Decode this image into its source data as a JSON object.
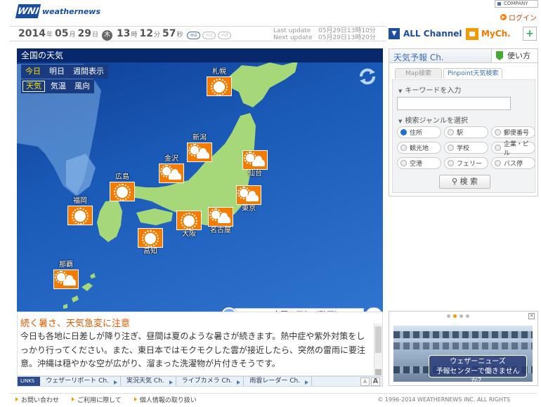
{
  "header": {
    "logo_mark": "WNI",
    "logo_text": "weathernews",
    "company_link": "COMPANY",
    "login_link": "ログイン"
  },
  "datebar": {
    "year": "2014",
    "year_unit": "年",
    "month": "05",
    "month_unit": "月",
    "day": "29",
    "day_unit": "日",
    "weekday": "木",
    "hour": "13",
    "hour_unit": "時",
    "minute": "12",
    "minute_unit": "分",
    "second": "57",
    "second_unit": "秒",
    "segments": [
      "m1",
      "m2",
      "m3"
    ],
    "last_update_label": "Last update",
    "last_update_value": "05月29日13時10分",
    "next_update_label": "Next update",
    "next_update_value": "05月29日13時20分"
  },
  "channels": {
    "all_channel": "ALL Channel",
    "my_channel": "MyCh.",
    "add": "+"
  },
  "map": {
    "title": "全国の天気",
    "period_tabs": [
      {
        "label": "今日",
        "active": true
      },
      {
        "label": "明日",
        "active": false
      },
      {
        "label": "週間表示",
        "active": false
      }
    ],
    "type_tabs": [
      {
        "label": "天気",
        "active": true
      },
      {
        "label": "気温",
        "active": false
      },
      {
        "label": "風向",
        "active": false
      }
    ],
    "cities": [
      {
        "name": "札幌",
        "weather": "sunny"
      },
      {
        "name": "新潟",
        "weather": "sunny-cloudy"
      },
      {
        "name": "仙台",
        "weather": "sunny-cloudy"
      },
      {
        "name": "金沢",
        "weather": "sunny-cloudy"
      },
      {
        "name": "東京",
        "weather": "sunny-cloudy"
      },
      {
        "name": "広島",
        "weather": "sunny"
      },
      {
        "name": "名古屋",
        "weather": "sunny-cloudy"
      },
      {
        "name": "大阪",
        "weather": "sunny"
      },
      {
        "name": "福岡",
        "weather": "sunny"
      },
      {
        "name": "高知",
        "weather": "sunny"
      },
      {
        "name": "那覇",
        "weather": "sunny-cloudy"
      }
    ],
    "colors": {
      "icon_bg": "#f57b00",
      "land": "#a6d87a",
      "sea": "#1a5ab7"
    }
  },
  "video": {
    "label": "全国の天気（動画）"
  },
  "forecast": {
    "title": "続く暑さ、天気急変に注意",
    "body": "今日も各地に日差しが降り注ぎ、昼間は夏のような暑さが続きます。熱中症や紫外対策をしっかり行ってください。また、東日本ではモクモクした雲が接近したら、突然の雷雨に要注意。沖縄は穏やかな空が広がり、溜まった洗濯物が片付きそうです。"
  },
  "links": {
    "label": "LINKS",
    "items": [
      "ウェザーリポート Ch.",
      "実況天気 Ch.",
      "ライブカメラ Ch.",
      "雨雲レーダー Ch."
    ],
    "font_small": "A",
    "font_large": "A"
  },
  "right_panel": {
    "title": "天気予報 Ch.",
    "howto": "使い方",
    "tabs": [
      {
        "label": "Map検索",
        "active": false
      },
      {
        "label": "Pinpoint天気検索",
        "active": true
      }
    ],
    "keyword_label": "キーワードを入力",
    "keyword_value": "",
    "genre_label": "検索ジャンルを選択",
    "genres": [
      {
        "label": "住所",
        "selected": true
      },
      {
        "label": "駅",
        "selected": false
      },
      {
        "label": "郵便番号",
        "selected": false
      },
      {
        "label": "観光地",
        "selected": false
      },
      {
        "label": "学校",
        "selected": false
      },
      {
        "label": "企業・ビル",
        "selected": false
      },
      {
        "label": "空港",
        "selected": false
      },
      {
        "label": "フェリー",
        "selected": false
      },
      {
        "label": "バス停",
        "selected": false
      }
    ],
    "search_button": "検 索"
  },
  "banner": {
    "caption_line1": "ウェザーニューズ",
    "caption_line2": "予報センターで働きませんか？"
  },
  "footer": {
    "links": [
      "お問い合わせ",
      "ご利用に際して",
      "個人情報の取り扱い"
    ],
    "copyright": "© 1996-2014 WEATHERNEWS INC. ALL RIGHTS"
  }
}
